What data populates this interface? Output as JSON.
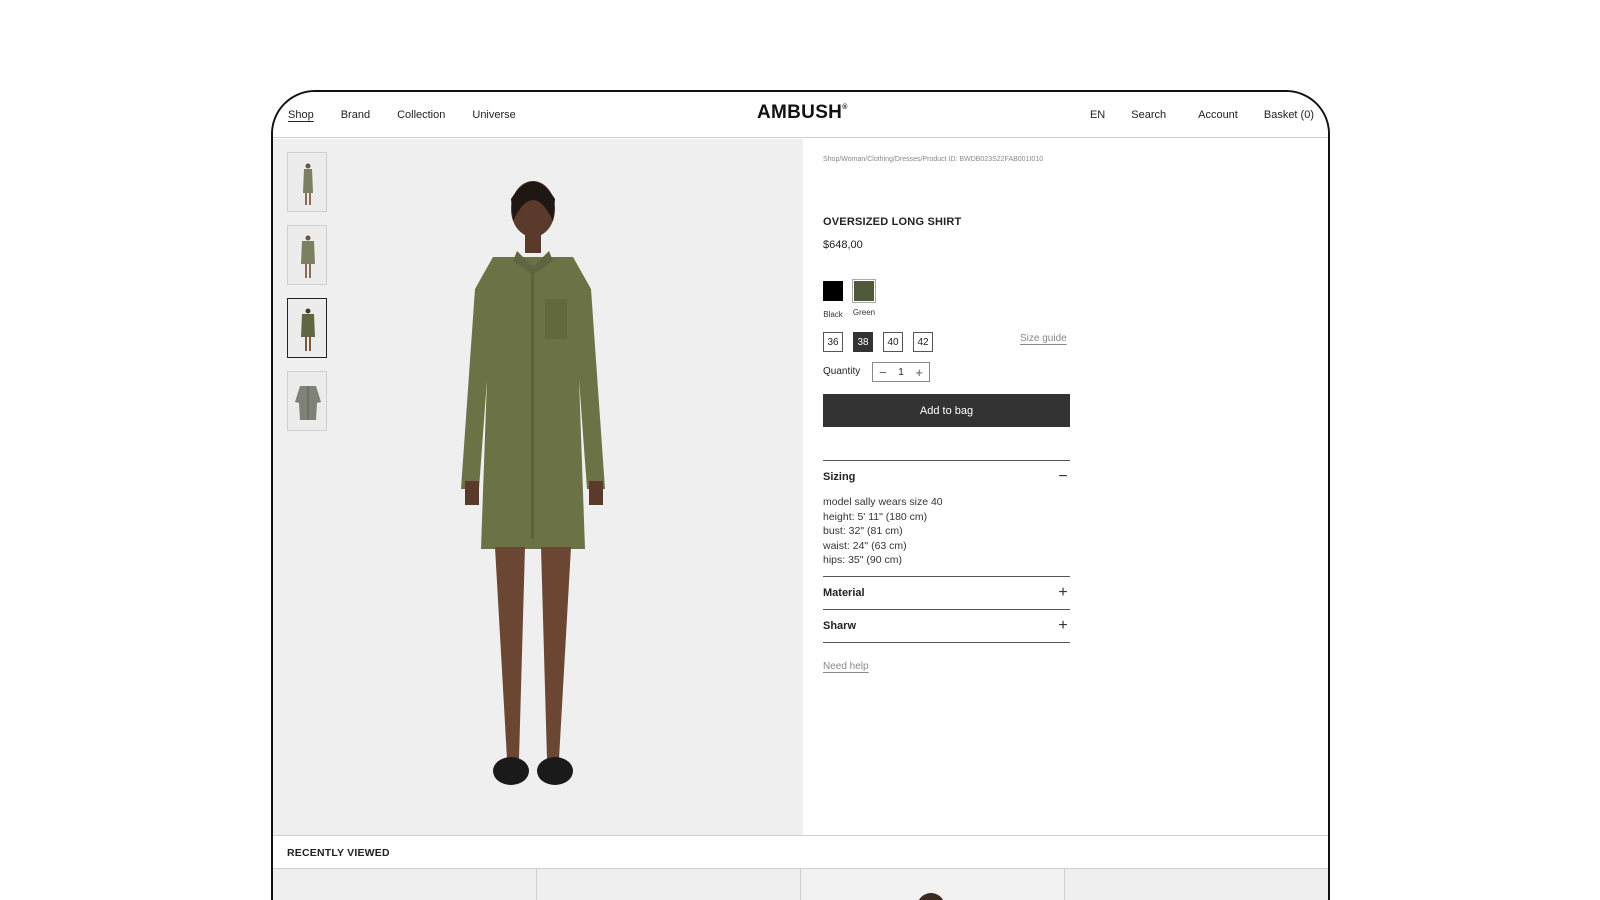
{
  "nav": {
    "left": [
      "Shop",
      "Brand",
      "Collection",
      "Universe"
    ],
    "logo": "AMBUSH",
    "logo_mark": "®",
    "lang": "EN",
    "search": "Search",
    "account": "Account",
    "basket": "Basket (0)"
  },
  "product": {
    "breadcrumb": "Shop/Woman/Clothing/Dresses/Product ID: BWDB023S22FAB001I010",
    "title": "OVERSIZED LONG SHIRT",
    "price": "$648,00",
    "colors": [
      {
        "label": "Black",
        "hex": "#000000"
      },
      {
        "label": "Green",
        "hex": "#4e5a39"
      }
    ],
    "sizes": [
      "36",
      "38",
      "40",
      "42"
    ],
    "selected_size": "38",
    "size_guide": "Size guide",
    "quantity_label": "Quantity",
    "quantity": "1",
    "add_to_bag": "Add to bag",
    "need_help": "Need help"
  },
  "accordion": {
    "sizing": {
      "title": "Sizing",
      "lines": [
        "model sally wears size 40",
        "height: 5' 11\" (180 cm)",
        "bust: 32\" (81 cm)",
        "waist: 24\" (63 cm)",
        "hips: 35\" (90 cm)"
      ]
    },
    "material": {
      "title": "Material"
    },
    "sharw": {
      "title": "Sharw"
    }
  },
  "recent": {
    "title": "RECENTLY VIEWED"
  },
  "colors": {
    "primary_button": "#333333",
    "garment": "#6b7246",
    "background_image": "#efefef"
  }
}
